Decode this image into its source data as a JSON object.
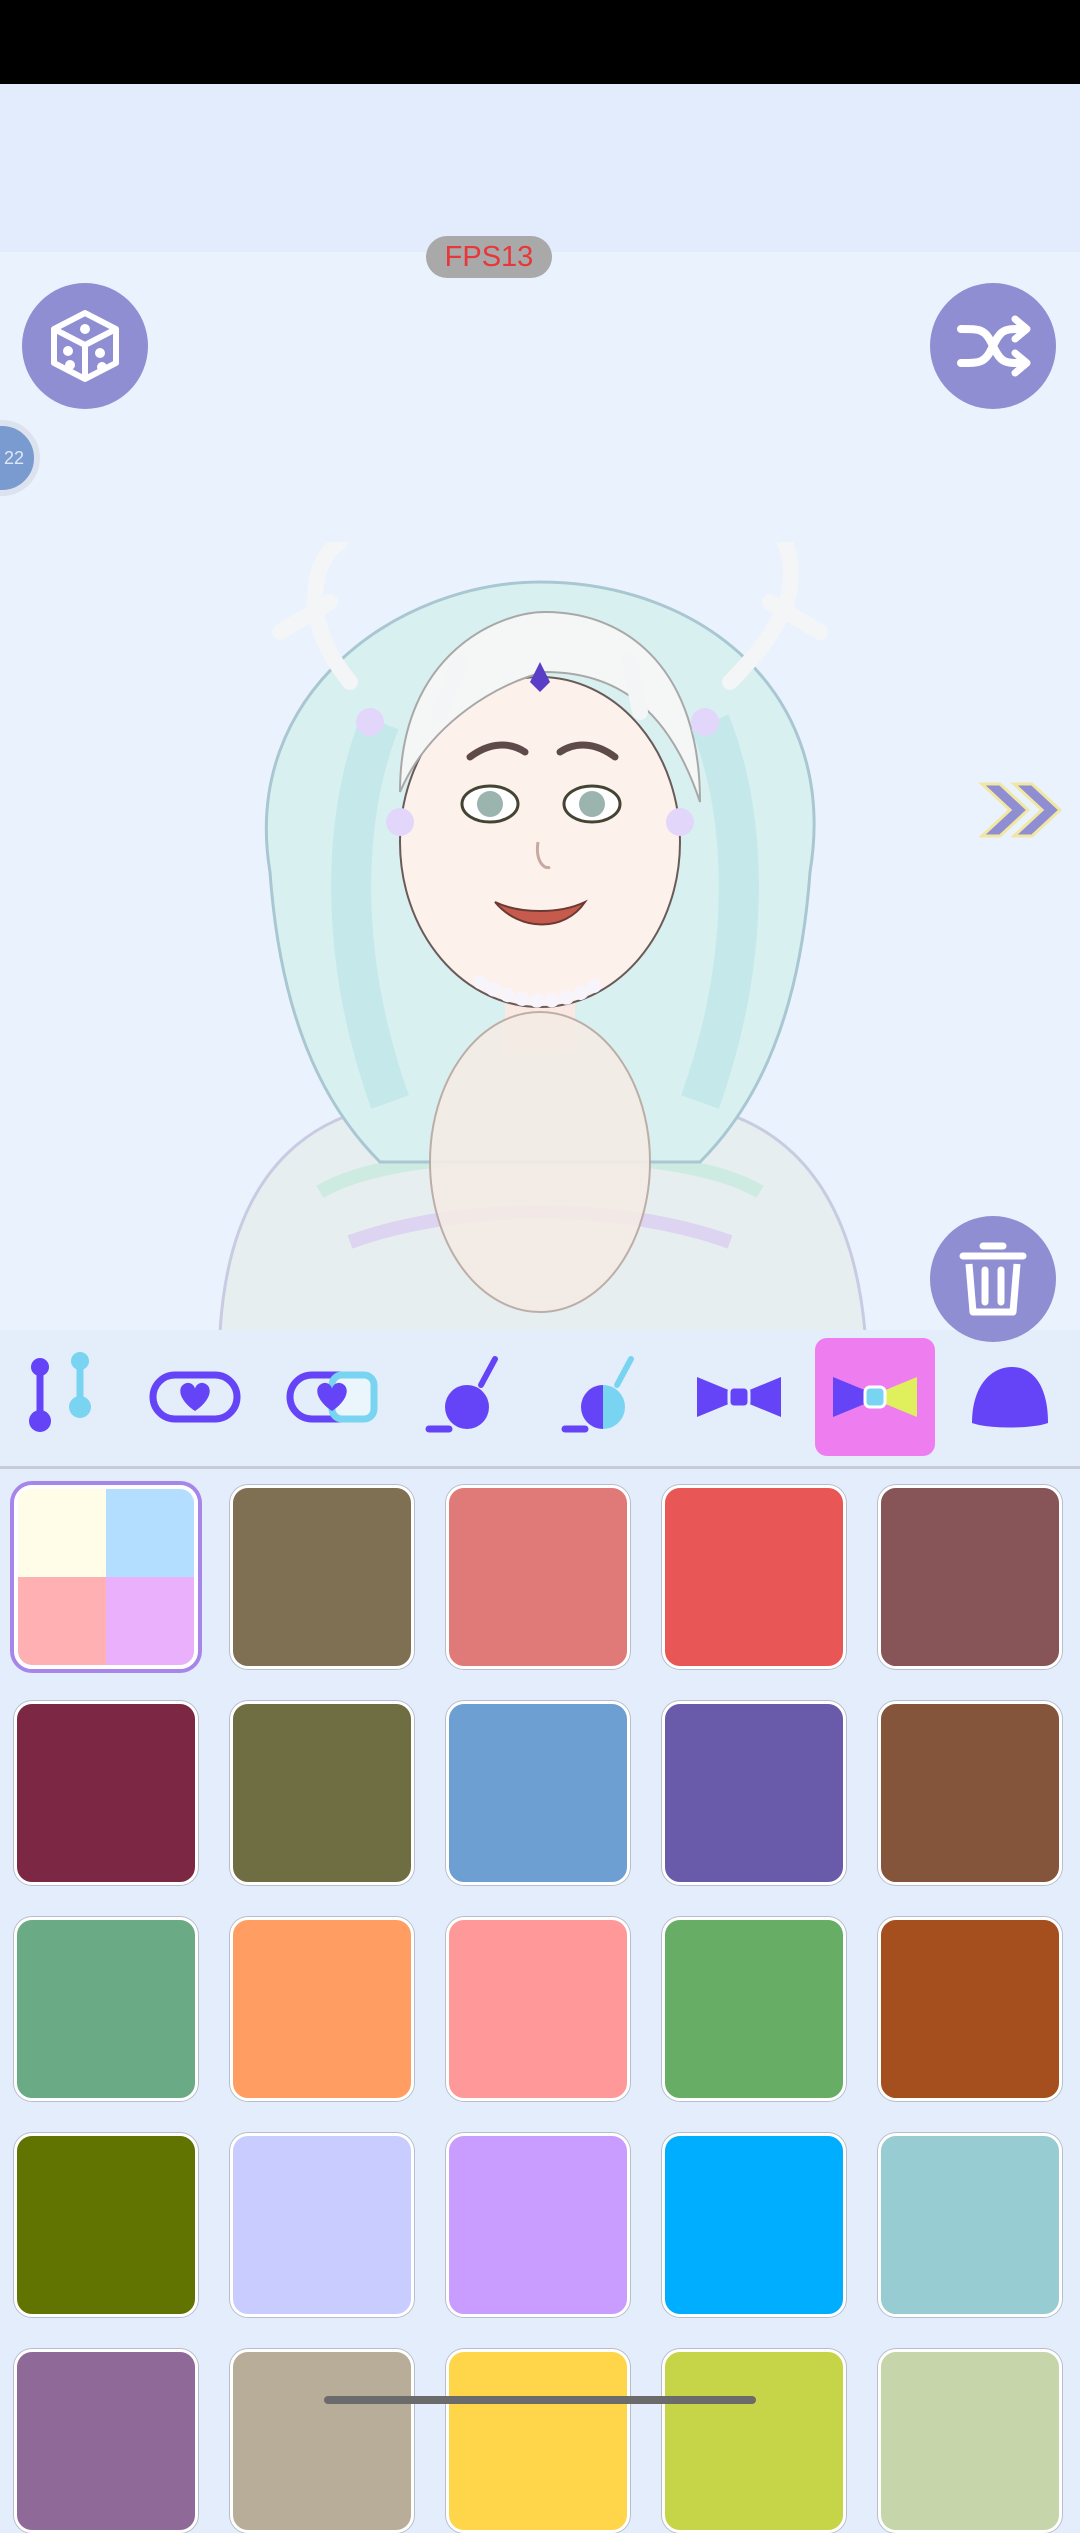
{
  "fps": {
    "label": "FPS13"
  },
  "level": {
    "text": "22"
  },
  "toolbar": {
    "tools": [
      {
        "name": "pin-pair-tool",
        "active": false
      },
      {
        "name": "heart-frame-tool",
        "active": false
      },
      {
        "name": "heart-frame-gradient-tool",
        "active": false
      },
      {
        "name": "brush-round-tool",
        "active": false
      },
      {
        "name": "brush-gradient-tool",
        "active": false
      },
      {
        "name": "bow-tool",
        "active": false
      },
      {
        "name": "bow-gradient-tool",
        "active": true
      },
      {
        "name": "blob-tool",
        "active": false
      }
    ]
  },
  "palette": {
    "selected_multi": [
      "#fffce7",
      "#b4deff",
      "#ffb0b3",
      "#eab0fc"
    ],
    "colors": [
      "#7f6f53",
      "#e07a79",
      "#e95656",
      "#875558",
      "#7c2744",
      "#6f6e43",
      "#6d9fd3",
      "#695ba9",
      "#84553b",
      "#6aaa84",
      "#ff9d62",
      "#ff9999",
      "#67ad66",
      "#a54e1e",
      "#617300",
      "#c9ccff",
      "#c99cff",
      "#00aeff",
      "#98ccd3",
      "#8f6a98",
      "#b8ad99",
      "#ffd649",
      "#c6d448",
      "#c6d6aa"
    ]
  },
  "theme": {
    "accent": "#8f8ed2",
    "icon": "#6444f6",
    "active_tab": "#ee7ef0"
  }
}
